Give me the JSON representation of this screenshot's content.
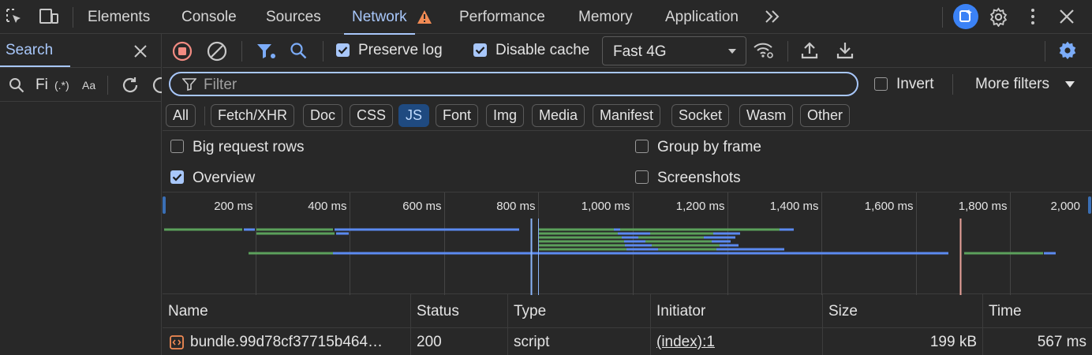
{
  "topbar": {
    "tabs": [
      {
        "label": "Elements"
      },
      {
        "label": "Console"
      },
      {
        "label": "Sources"
      },
      {
        "label": "Network",
        "active": true
      },
      {
        "label": "Performance"
      },
      {
        "label": "Memory"
      },
      {
        "label": "Application"
      }
    ],
    "overflow_icon": "chevron-double-right-icon",
    "warning_color": "#f28b54",
    "accent_color": "#a8c7fa"
  },
  "search_panel": {
    "tab_label": "Search",
    "query_value": "Fi",
    "regex_label": "(.*)",
    "case_label": "Aa"
  },
  "toolbar": {
    "record_color": "#f28b82",
    "preserve_log": {
      "label": "Preserve log",
      "checked": true
    },
    "disable_cache": {
      "label": "Disable cache",
      "checked": true
    },
    "throttling": {
      "selected": "Fast 4G"
    }
  },
  "filter": {
    "placeholder": "Filter",
    "invert": {
      "label": "Invert",
      "checked": false
    },
    "more_filters": "More filters"
  },
  "type_filters": [
    {
      "label": "All"
    },
    {
      "label": "Fetch/XHR"
    },
    {
      "label": "Doc"
    },
    {
      "label": "CSS"
    },
    {
      "label": "JS",
      "active": true
    },
    {
      "label": "Font"
    },
    {
      "label": "Img"
    },
    {
      "label": "Media"
    },
    {
      "label": "Manifest"
    },
    {
      "label": "Socket"
    },
    {
      "label": "Wasm"
    },
    {
      "label": "Other"
    }
  ],
  "options": {
    "big_request_rows": {
      "label": "Big request rows",
      "checked": false
    },
    "group_by_frame": {
      "label": "Group by frame",
      "checked": false
    },
    "overview": {
      "label": "Overview",
      "checked": true
    },
    "screenshots": {
      "label": "Screenshots",
      "checked": false
    }
  },
  "overview": {
    "ticks": [
      "200 ms",
      "400 ms",
      "600 ms",
      "800 ms",
      "1,000 ms",
      "1,200 ms",
      "1,400 ms",
      "1,600 ms",
      "1,800 ms",
      "2,000"
    ],
    "colors": {
      "waiting": "#5ba05b",
      "download": "#5b8af0",
      "dcl": "#8ab4f8",
      "load": "#e8a29a"
    }
  },
  "table": {
    "columns": [
      "Name",
      "Status",
      "Type",
      "Initiator",
      "Size",
      "Time"
    ],
    "rows": [
      {
        "name": "bundle.99d78cf37715b464…",
        "status": "200",
        "type": "script",
        "initiator": "(index):1",
        "size": "199 kB",
        "time": "567 ms"
      }
    ]
  }
}
